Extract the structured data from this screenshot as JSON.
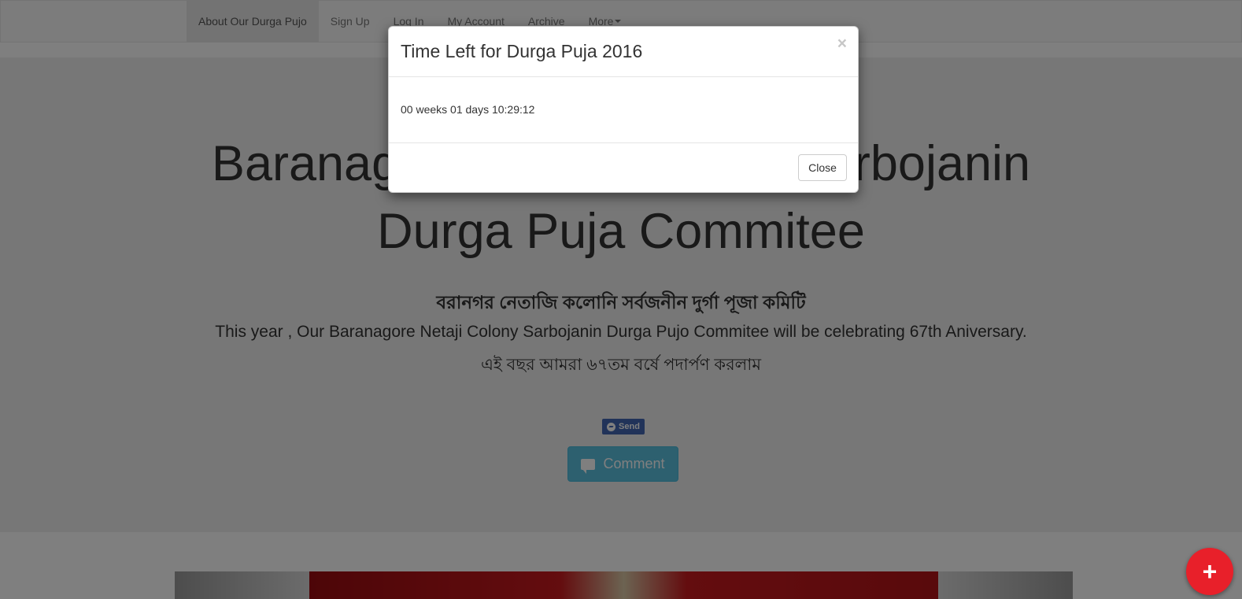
{
  "nav": {
    "items": [
      {
        "label": "About Our Durga Pujo"
      },
      {
        "label": "Sign Up"
      },
      {
        "label": "Log In"
      },
      {
        "label": "My Account"
      },
      {
        "label": "Archive"
      },
      {
        "label": "More"
      }
    ]
  },
  "hero": {
    "title": "Baranagore Netaji Colony Sarbojanin Durga Puja Commitee",
    "bengali_title": "বরানগর নেতাজি কলোনি সর্বজনীন দুর্গা পূজা কমিটি",
    "anniversary_text": "This year , Our Baranagore Netaji Colony Sarbojanin Durga Pujo Commitee will be celebrating 67th Aniversary.",
    "bengali_subtitle": "এই বছর আমরা ৬৭তম বর্ষে পদার্পণ করলাম",
    "send_label": "Send",
    "comment_label": "Comment"
  },
  "modal": {
    "title": "Time Left for Durga Puja 2016",
    "close_symbol": "×",
    "countdown": "00 weeks 01 days 10:29:12",
    "close_label": "Close"
  },
  "fab": {
    "symbol": "+"
  },
  "colors": {
    "fab": "#e8202a",
    "comment_button": "#5bc0de",
    "send_button": "#4267b2"
  }
}
